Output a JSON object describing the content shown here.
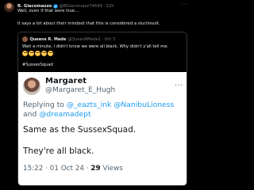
{
  "post": {
    "author_name": "B. Giacomazzo",
    "author_handle": "@BGiacomazz74649",
    "separator": "·",
    "time": "12h",
    "more_icon": "more-icon",
    "text_line1": "Well, even if that were true...",
    "text_line2": "It says a lot about their mindset that this is considered a slur/insult."
  },
  "quote": {
    "author_name": "Queens R. Made",
    "author_handle": "@QueenRMade1",
    "separator": "·",
    "time": "Oct 3",
    "text": "Wait a minute, I didn't know we were all black. Why didn't y'all tell me.",
    "emoji_count": 5,
    "hashtag": "#SussexSquad"
  },
  "embedded": {
    "name": "Margaret",
    "handle": "@Margaret_E_Hugh",
    "reply_prefix": "Replying to",
    "mentions": [
      "@_eazts_ink",
      "@NanibuLioness",
      "@dreamadept"
    ],
    "and_word": "and",
    "body1": "Same as the SussexSquad.",
    "body2": "They're all black.",
    "timestamp": "15:22 · 01 Oct 24 · ",
    "views_count": "29",
    "views_label": " Views"
  },
  "colors": {
    "background": "#000000",
    "text": "#e7e9ea",
    "muted": "#71767b",
    "verified": "#1d9bf0",
    "link": "#1d9bf0"
  }
}
